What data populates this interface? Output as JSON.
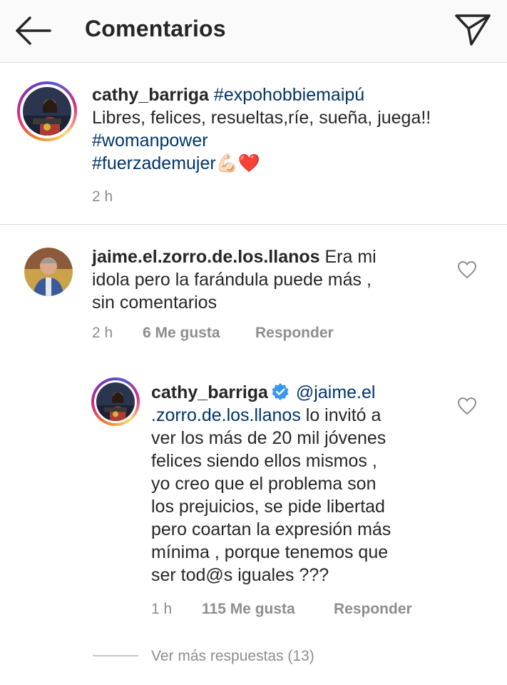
{
  "header": {
    "title": "Comentarios",
    "back_icon": "arrow-left-icon",
    "send_icon": "paper-plane-icon"
  },
  "caption": {
    "username": "cathy_barriga",
    "hashtag_1": "#expohobbiemaipú",
    "line_1": "Libres, felices, resueltas,ríe, sueña, juega!!",
    "hashtag_2": "#womanpower",
    "hashtag_3": "#fuerzademujer",
    "emoji": "💪🏻❤️",
    "time": "2 h"
  },
  "comments": [
    {
      "username": "jaime.el.zorro.de.los.llanos",
      "text_part_1": "Era mi",
      "text_line_2": "idola pero la farándula puede más ,",
      "text_line_3": "sin comentarios",
      "time": "2 h",
      "likes": "6 Me gusta",
      "reply_label": "Responder"
    }
  ],
  "reply": {
    "username": "cathy_barriga",
    "mention_part_1": "@jaime.el",
    "mention_part_2": ".zorro.de.los.llanos",
    "text_part_1": "lo invitó a",
    "text_line_3": "ver los más de 20 mil jóvenes",
    "text_line_4": "felices siendo ellos mismos ,",
    "text_line_5": "yo creo que el problema son",
    "text_line_6": "los prejuicios, se pide libertad",
    "text_line_7": "pero coartan la expresión más",
    "text_line_8": "mínima , porque tenemos que",
    "text_line_9": "ser tod@s iguales ???",
    "time": "1 h",
    "likes": "115 Me gusta",
    "reply_label": "Responder"
  },
  "more_replies": "Ver más respuestas (13)",
  "colors": {
    "hashtag": "#003569",
    "muted": "#8e8e8e",
    "verified": "#3897f0"
  }
}
